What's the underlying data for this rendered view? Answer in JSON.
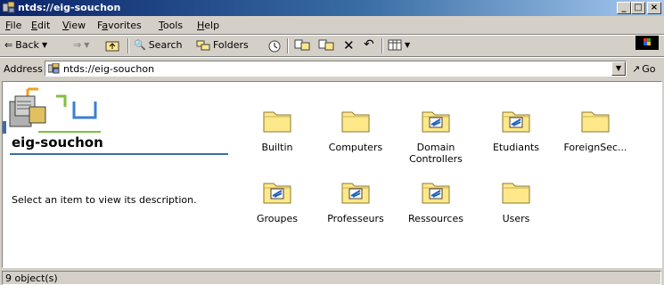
{
  "window": {
    "title": "ntds://eig-souchon"
  },
  "window_controls": {
    "minimize": "_",
    "maximize": "□",
    "close": "×"
  },
  "menu": [
    "File",
    "Edit",
    "View",
    "Favorites",
    "Tools",
    "Help"
  ],
  "menu_underline": [
    "F",
    "E",
    "V",
    "a",
    "T",
    "H"
  ],
  "toolbar": {
    "back": "Back",
    "search": "Search",
    "folders": "Folders"
  },
  "address": {
    "label": "Address",
    "value": "ntds://eig-souchon",
    "go": "Go"
  },
  "left_pane": {
    "folder_name": "eig-souchon",
    "description": "Select an item to view its description."
  },
  "items": [
    {
      "label": "Builtin",
      "icon": "folder-icon"
    },
    {
      "label": "Computers",
      "icon": "folder-icon"
    },
    {
      "label": "Domain Controllers",
      "icon": "ou-folder-icon"
    },
    {
      "label": "Etudiants",
      "icon": "ou-folder-icon"
    },
    {
      "label": "ForeignSec...",
      "icon": "folder-icon"
    },
    {
      "label": "Groupes",
      "icon": "ou-folder-icon"
    },
    {
      "label": "Professeurs",
      "icon": "ou-folder-icon"
    },
    {
      "label": "Ressources",
      "icon": "ou-folder-icon"
    },
    {
      "label": "Users",
      "icon": "folder-icon"
    }
  ],
  "status": {
    "text": "9 object(s)"
  },
  "colors": {
    "titlebar": "#0a246a",
    "folder": "#ffe88a",
    "accent": "#3a6ea5"
  }
}
